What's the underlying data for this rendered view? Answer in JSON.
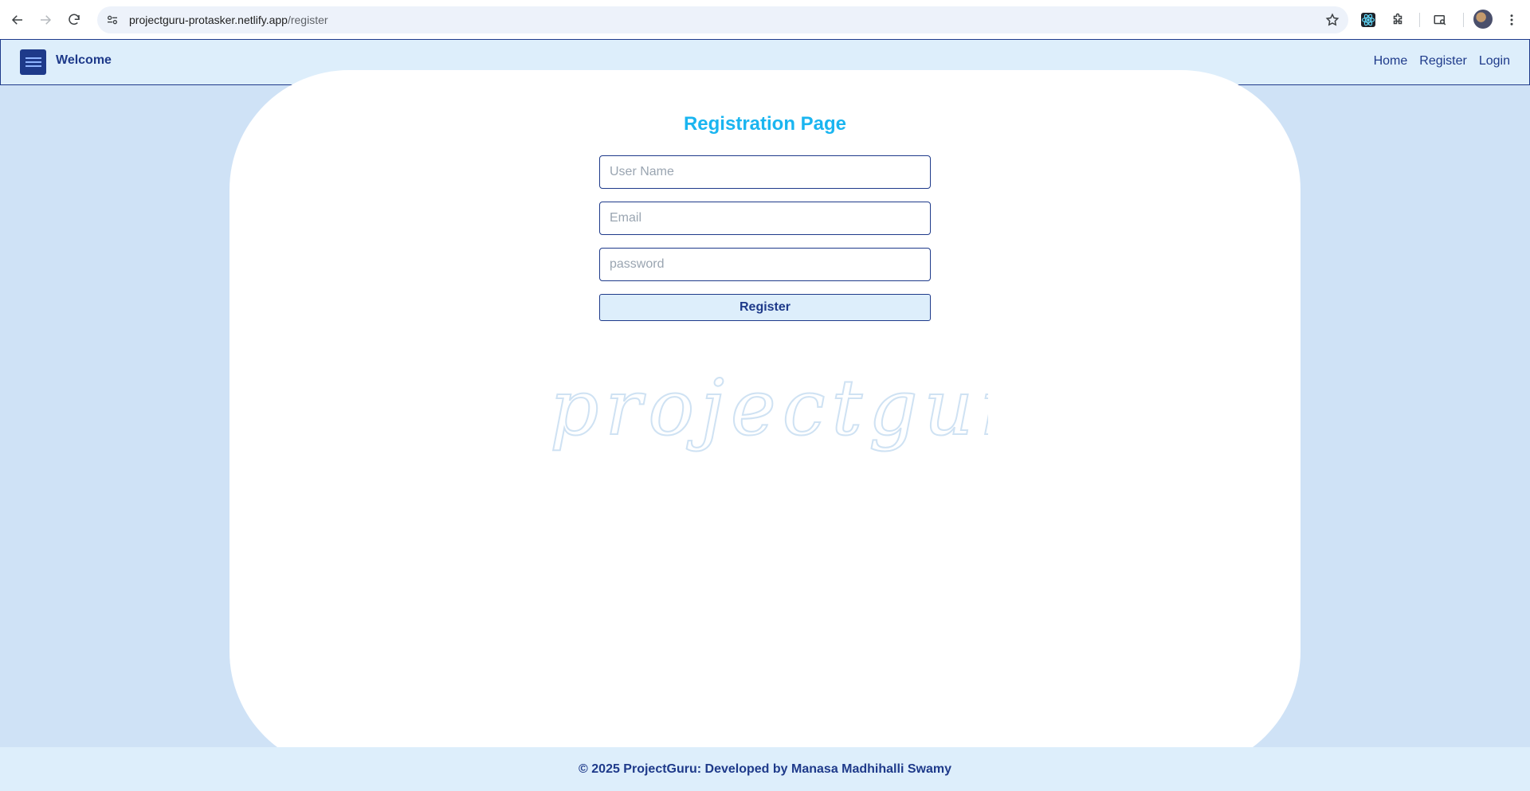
{
  "browser": {
    "url_host": "projectguru-protasker.netlify.app",
    "url_path": "/register"
  },
  "header": {
    "brand": "Welcome",
    "nav": [
      "Home",
      "Register",
      "Login"
    ]
  },
  "form": {
    "title": "Registration Page",
    "username_placeholder": "User Name",
    "email_placeholder": "Email",
    "password_placeholder": "password",
    "submit_label": "Register"
  },
  "watermark": "projectguru",
  "footer": {
    "text": "© 2025 ProjectGuru: Developed by Manasa Madhihalli Swamy"
  },
  "colors": {
    "primary": "#1e3a8a",
    "accent": "#1ab5f0",
    "background": "#cfe2f6",
    "header_bg": "#ddeefb"
  }
}
